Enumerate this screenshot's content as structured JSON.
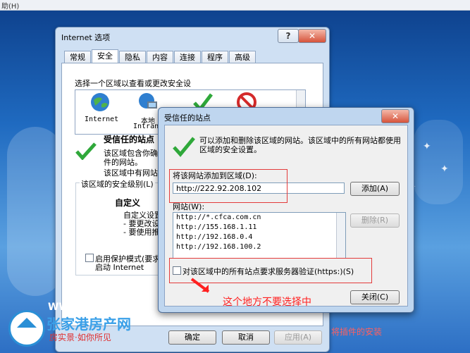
{
  "menu": {
    "help": "助(H)"
  },
  "internet_options": {
    "title": "Internet 选项",
    "help_btn": "?",
    "close_btn": "✕",
    "tabs": [
      "常规",
      "安全",
      "隐私",
      "内容",
      "连接",
      "程序",
      "高级"
    ],
    "zone_prompt": "选择一个区域以查看或更改安全设",
    "zones": [
      {
        "label": "Internet"
      },
      {
        "label": "本地"
      },
      {
        "label": "Intrane"
      }
    ],
    "trusted_title": "受信任的站点",
    "trusted_desc1": "该区域包含你确",
    "trusted_desc2": "件的网站。",
    "trusted_desc3": "该区域中有网站",
    "level_group": "该区域的安全级别(L)",
    "custom": "自定义",
    "custom_line1": "自定义设置",
    "custom_line2": "- 要更改设",
    "custom_line3": "- 要使用推",
    "protected_mode": "启用保护模式(要求",
    "protected_mode2": "启动 Internet",
    "ok": "确定",
    "cancel": "取消",
    "apply": "应用(A)"
  },
  "trusted_dialog": {
    "title": "受信任的站点",
    "info": "可以添加和删除该区域的网站。该区域中的所有网站都使用区域的安全设置。",
    "add_label": "将该网站添加到区域(D):",
    "url_value": "http://222.92.208.102",
    "add_btn": "添加(A)",
    "sites_label": "网站(W):",
    "sites": [
      "http://*.cfca.com.cn",
      "http://155.168.1.11",
      "http://192.168.0.4",
      "http://192.168.100.2"
    ],
    "remove_btn": "删除(R)",
    "require_https": "对该区域中的所有站点要求服务器验证(https:)(S)",
    "close_btn": "关闭(C)"
  },
  "annotation": "这个地方不要选择中",
  "watermark": {
    "url": "WWW.ZJGZF.CN",
    "name": "张家港房产网",
    "slogan": "房实景·如你所见"
  },
  "right_hint": "将插件的安装"
}
